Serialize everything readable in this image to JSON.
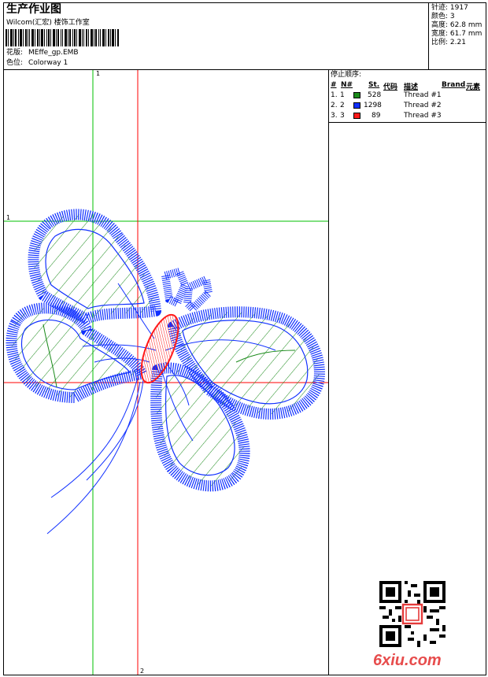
{
  "header": {
    "title": "生产作业图",
    "company": "Wilcom(汇宏) 楼饰工作室",
    "design_label": "花版:",
    "design_value": "MEffe_gp.EMB",
    "colorway_label": "色位:",
    "colorway_value": "Colorway 1"
  },
  "stats": [
    {
      "label": "针迹:",
      "value": "1917"
    },
    {
      "label": "颜色:",
      "value": "3"
    },
    {
      "label": "高度:",
      "value": "62.8 mm"
    },
    {
      "label": "宽度:",
      "value": "61.7 mm"
    },
    {
      "label": "比例:",
      "value": "2.21"
    }
  ],
  "stop_sequence": {
    "title": "停止顺序:",
    "headers": [
      "#",
      "N#",
      "St.",
      "代码",
      "描述",
      "Brand",
      "元素"
    ],
    "rows": [
      {
        "idx": "1.",
        "n": "1",
        "color": "#1a8a1a",
        "stitches": "528",
        "desc": "Thread #1"
      },
      {
        "idx": "2.",
        "n": "2",
        "color": "#1030ff",
        "stitches": "1298",
        "desc": "Thread #2"
      },
      {
        "idx": "3.",
        "n": "3",
        "color": "#ff1a1a",
        "stitches": "89",
        "desc": "Thread #3"
      }
    ]
  },
  "guides": {
    "v1": "1",
    "h1": "1",
    "v2": "2"
  },
  "watermark": {
    "text": "6xiu.com"
  },
  "colors": {
    "green_guide": "#00c000",
    "red_guide": "#ff0000",
    "fill_green": "#1a8a1a",
    "satin_blue": "#1030ff",
    "body_red": "#ff1a1a"
  }
}
